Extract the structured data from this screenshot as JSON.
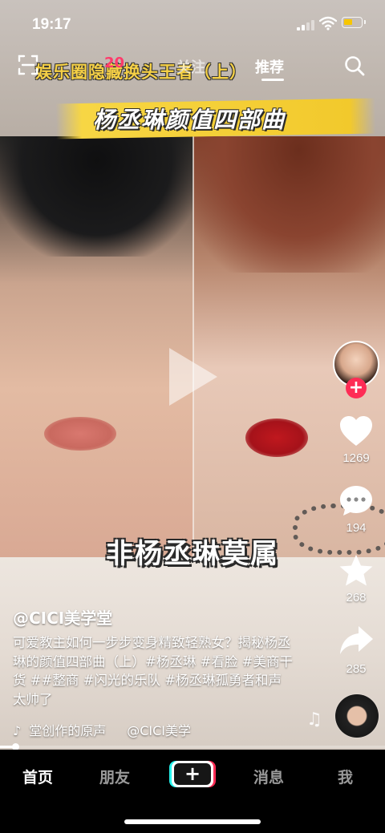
{
  "status_bar": {
    "time": "19:17"
  },
  "top_nav": {
    "tabs": [
      {
        "label": "关注"
      },
      {
        "label": "推荐"
      }
    ]
  },
  "video": {
    "caption_top": "娱乐圈隐藏换头王者（上）",
    "caption_number": "20",
    "title_text": "杨丞琳颜值四部曲",
    "bottom_text": "非杨丞琳莫属"
  },
  "right_rail": {
    "like_count": "1269",
    "comment_count": "194",
    "favorite_count": "268",
    "share_count": "285"
  },
  "caption": {
    "author": "@CICI美学堂",
    "description": "可爱教主如何一步步变身精致轻熟女？揭秘杨丞琳的颜值四部曲（上）#杨丞琳 #看脸 #美商干货 ##整商 #闪光的乐队 #杨丞琳孤勇者和声太帅了",
    "audio_label": "堂创作的原声",
    "audio_author": "@CICI美学"
  },
  "playback": {
    "progress_fraction": 0.04
  },
  "tab_bar": {
    "home": "首页",
    "friends": "朋友",
    "create": "+",
    "messages": "消息",
    "me": "我"
  },
  "colors": {
    "accent_red": "#fe2c55",
    "accent_cyan": "#25f4ee",
    "caption_yellow": "#f5d046"
  }
}
